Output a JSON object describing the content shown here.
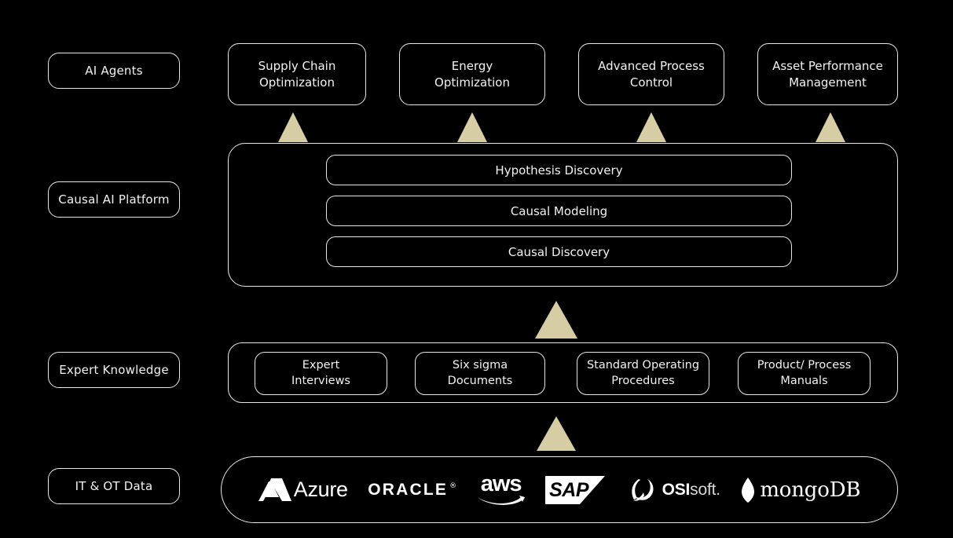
{
  "theme": {
    "background": "#000000",
    "stroke": "#e8e8e8",
    "text": "#f2f2f2",
    "arrow": "#d6cda4"
  },
  "tiers": [
    {
      "id": "ai-agents",
      "label": "AI Agents"
    },
    {
      "id": "causal-ai-platform",
      "label": "Causal AI Platform"
    },
    {
      "id": "expert-knowledge",
      "label": "Expert Knowledge"
    },
    {
      "id": "it-ot-data",
      "label": "IT & OT Data"
    }
  ],
  "agents": [
    {
      "line1": "Supply Chain",
      "line2": "Optimization"
    },
    {
      "line1": "Energy",
      "line2": "Optimization"
    },
    {
      "line1": "Advanced Process",
      "line2": "Control"
    },
    {
      "line1": "Asset Performance",
      "line2": "Management"
    }
  ],
  "platform": {
    "capabilities": [
      {
        "label": "Hypothesis Discovery"
      },
      {
        "label": "Causal Modeling"
      },
      {
        "label": "Causal Discovery"
      }
    ]
  },
  "expert_knowledge": {
    "sources": [
      {
        "line1": "Expert",
        "line2": "Interviews"
      },
      {
        "line1": "Six sigma",
        "line2": "Documents"
      },
      {
        "line1": "Standard Operating",
        "line2": "Procedures"
      },
      {
        "line1": "Product/ Process",
        "line2": "Manuals"
      }
    ]
  },
  "data_sources": {
    "logos": [
      {
        "id": "azure",
        "name": "Azure",
        "icon": "azure-icon"
      },
      {
        "id": "oracle",
        "name": "ORACLE",
        "icon": "oracle-wordmark",
        "tm": "®"
      },
      {
        "id": "aws",
        "name": "aws",
        "icon": "aws-swoosh-icon"
      },
      {
        "id": "sap",
        "name": "SAP",
        "icon": "sap-icon",
        "tm": "®"
      },
      {
        "id": "osisoft",
        "name_bold": "OSI",
        "name_light": "soft.",
        "icon": "osisoft-swirl-icon"
      },
      {
        "id": "mongodb",
        "name": "mongoDB",
        "icon": "mongodb-leaf-icon"
      }
    ]
  },
  "arrows": {
    "label": "upward flow arrow",
    "count": 6
  }
}
